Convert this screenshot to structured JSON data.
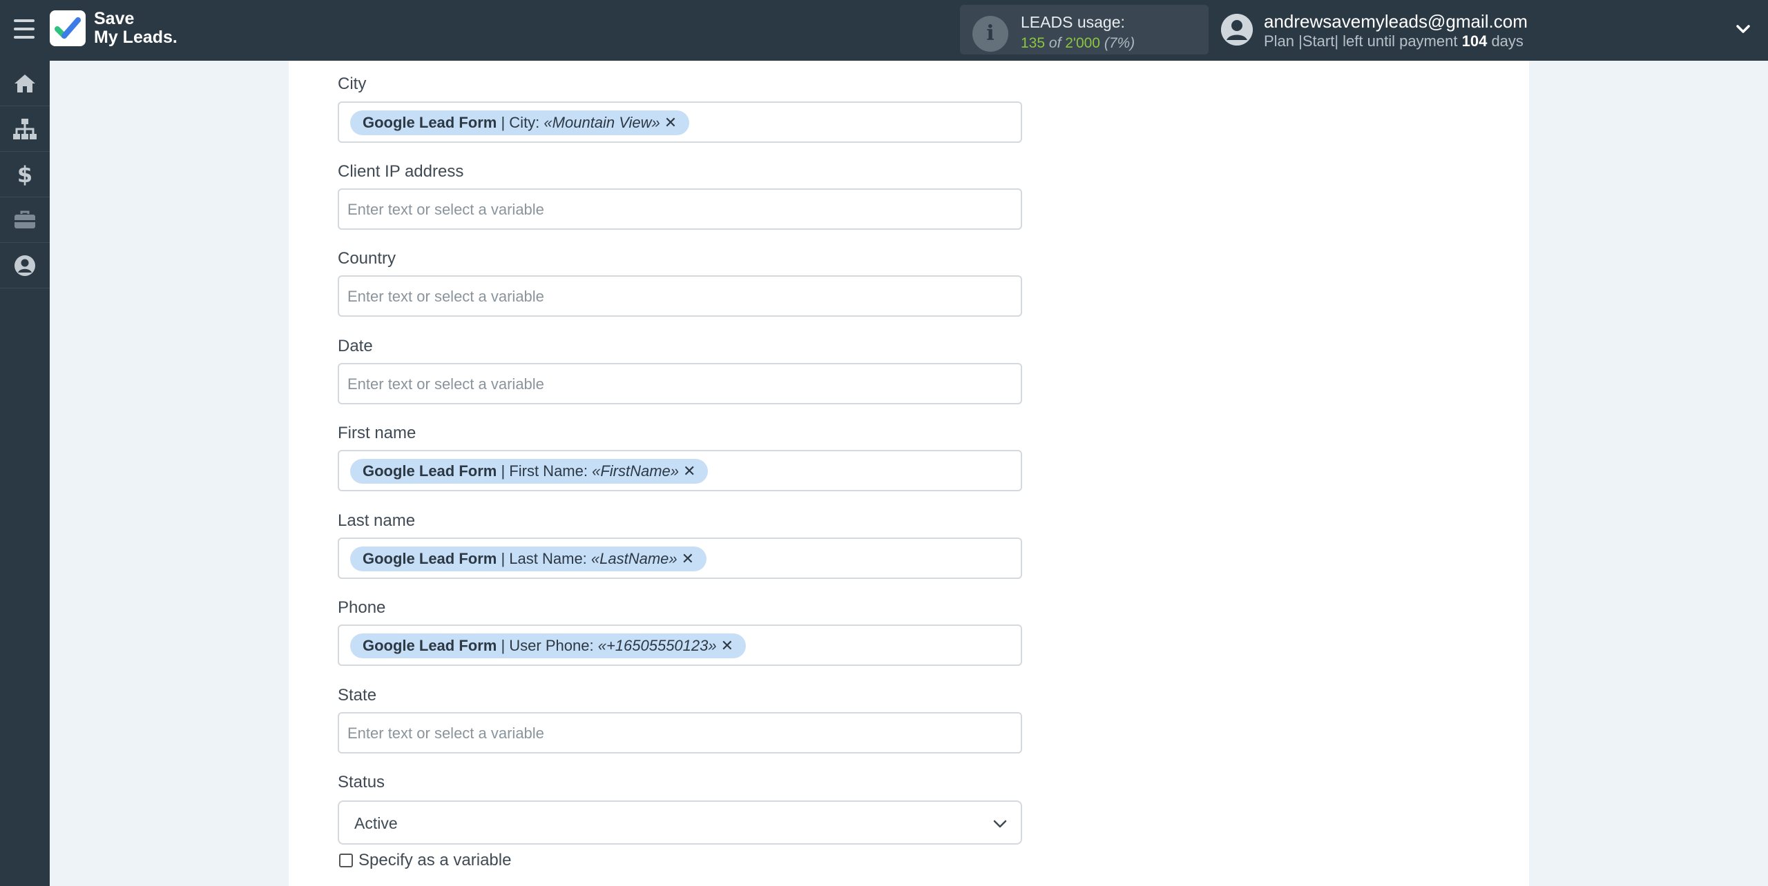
{
  "header": {
    "logo_line1": "Save",
    "logo_line2": "My Leads.",
    "usage_title": "LEADS usage:",
    "usage_used": "135",
    "usage_of": "of",
    "usage_total": "2'000",
    "usage_percent": "(7%)",
    "email": "andrewsavemyleads@gmail.com",
    "plan_prefix": "Plan |Start| left until payment",
    "plan_days": "104",
    "plan_suffix": "days"
  },
  "sidebar": {
    "items": [
      {
        "icon": "home-icon"
      },
      {
        "icon": "sitemap-icon"
      },
      {
        "icon": "dollar-icon"
      },
      {
        "icon": "briefcase-icon"
      },
      {
        "icon": "user-circle-icon"
      }
    ]
  },
  "placeholder": "Enter text or select a variable",
  "fields": {
    "city": {
      "label": "City",
      "tag_source": "Google Lead Form",
      "tag_field": " | City: ",
      "tag_value": "«Mountain View»"
    },
    "client_ip": {
      "label": "Client IP address"
    },
    "country": {
      "label": "Country"
    },
    "date": {
      "label": "Date"
    },
    "first_name": {
      "label": "First name",
      "tag_source": "Google Lead Form",
      "tag_field": " | First Name: ",
      "tag_value": "«FirstName»"
    },
    "last_name": {
      "label": "Last name",
      "tag_source": "Google Lead Form",
      "tag_field": " | Last Name: ",
      "tag_value": "«LastName»"
    },
    "phone": {
      "label": "Phone",
      "tag_source": "Google Lead Form",
      "tag_field": " | User Phone: ",
      "tag_value": "«+16505550123»"
    },
    "state": {
      "label": "State"
    },
    "status": {
      "label": "Status",
      "value": "Active",
      "checkbox_label": "Specify as a variable"
    }
  },
  "colors": {
    "topbar": "#2b3945",
    "tag_bg": "#c7def7",
    "usage_green": "#8cc63f"
  }
}
